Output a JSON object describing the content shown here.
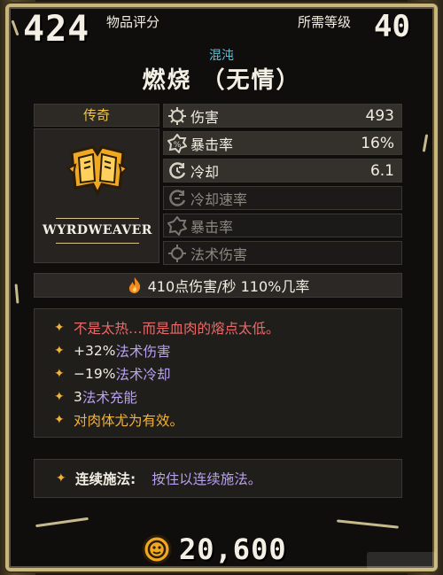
{
  "header": {
    "item_score": "424",
    "item_score_label": "物品评分",
    "required_level_label": "所需等级",
    "required_level": "40"
  },
  "item": {
    "alignment": "混沌",
    "title": "燃烧 （无情）",
    "rarity": "传奇",
    "maker": "WYRDWEAVER"
  },
  "stats": [
    {
      "icon": "damage-icon",
      "name": "伤害",
      "value": "493",
      "active": true
    },
    {
      "icon": "crit-chance-icon",
      "name": "暴击率",
      "value": "16%",
      "active": true
    },
    {
      "icon": "cooldown-icon",
      "name": "冷却",
      "value": "6.1",
      "active": true
    },
    {
      "icon": "cooldown-rate-icon",
      "name": "冷却速率",
      "value": "",
      "active": false
    },
    {
      "icon": "crit-chance-icon",
      "name": "暴击率",
      "value": "",
      "active": false
    },
    {
      "icon": "spell-damage-icon",
      "name": "法术伤害",
      "value": "",
      "active": false
    }
  ],
  "dps": {
    "icon": "flame-icon",
    "text": "410点伤害/秒  110%几率"
  },
  "description": {
    "lore": "不是太热…而是血肉的熔点太低。",
    "mods": [
      {
        "num": "+32%",
        "stat": "法术伤害"
      },
      {
        "num": "−19%",
        "stat": "法术冷却"
      },
      {
        "num": "3",
        "stat": "法术充能"
      }
    ],
    "effect": "对肉体尤为有效。"
  },
  "ability": {
    "name": "连续施法:",
    "desc": "按住以连续施法。"
  },
  "price": {
    "icon": "coin-icon",
    "value": "20,600"
  },
  "colors": {
    "frame": "#c9b67a",
    "alignment": "#4fc6e4",
    "rarity": "#f0c64d",
    "lore": "#e96a6a",
    "spell_stat": "#b8a1ee",
    "effect": "#f0b23c"
  }
}
